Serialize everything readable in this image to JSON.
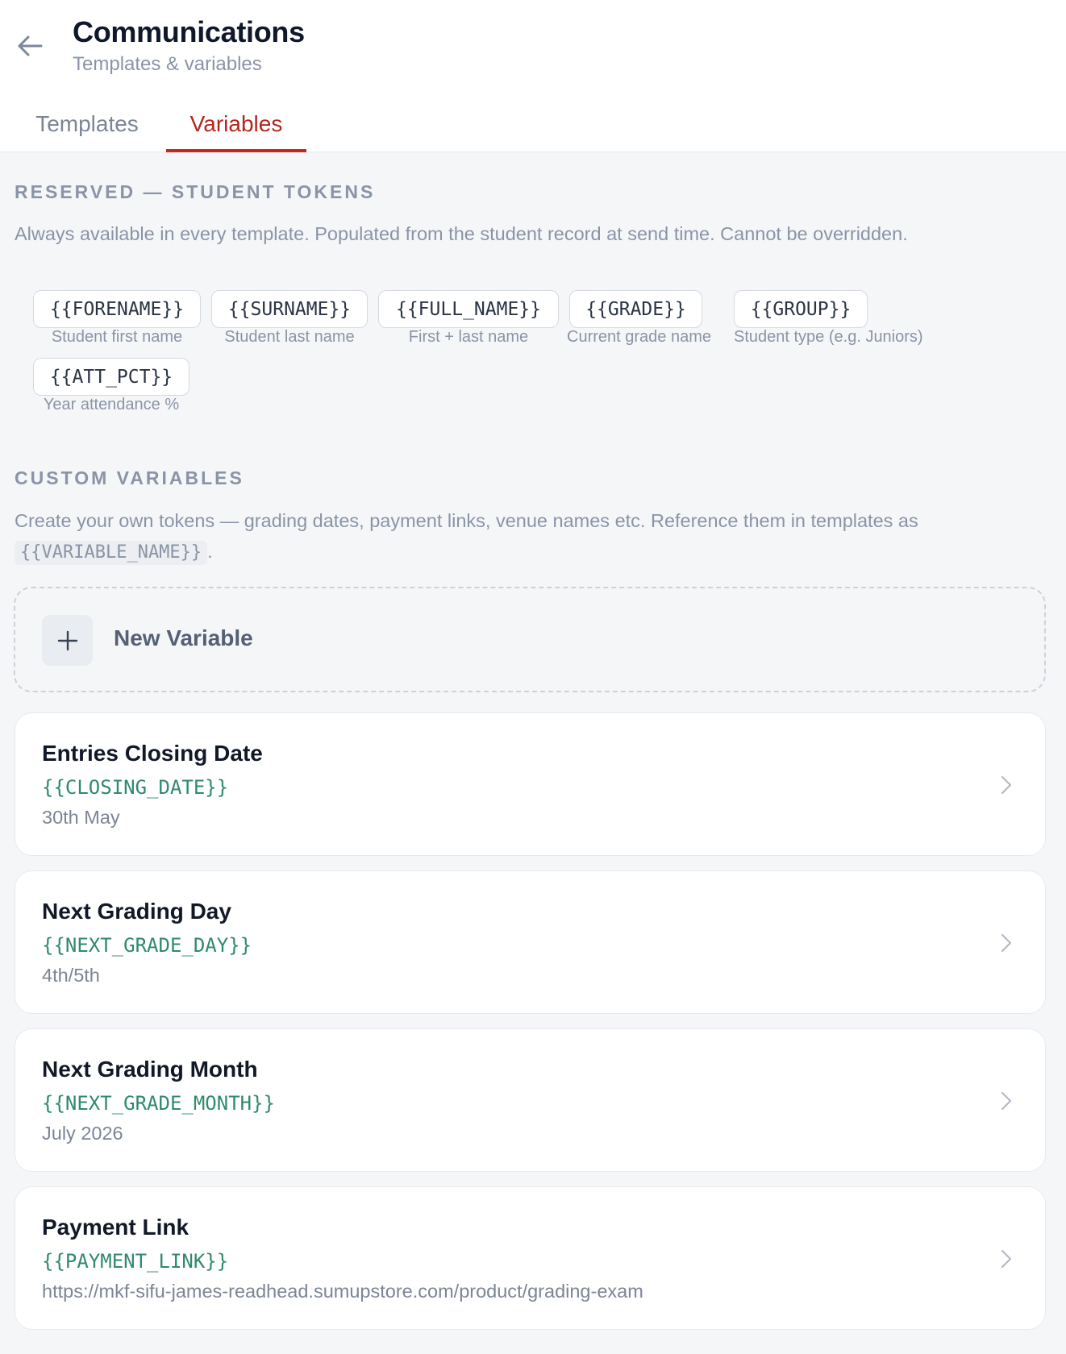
{
  "header": {
    "title": "Communications",
    "subtitle": "Templates & variables",
    "back_icon": "arrow-left-icon"
  },
  "tabs": [
    {
      "label": "Templates",
      "active": false
    },
    {
      "label": "Variables",
      "active": true
    }
  ],
  "reserved": {
    "heading": "RESERVED — STUDENT TOKENS",
    "description": "Always available in every template. Populated from the student record at send time. Cannot be overridden.",
    "tokens": [
      {
        "token": "{{FORENAME}}",
        "label": "Student first name"
      },
      {
        "token": "{{SURNAME}}",
        "label": "Student last name"
      },
      {
        "token": "{{FULL_NAME}}",
        "label": "First + last name"
      },
      {
        "token": "{{GRADE}}",
        "label": "Current grade name"
      },
      {
        "token": "{{GROUP}}",
        "label": "Student type (e.g. Juniors)"
      },
      {
        "token": "{{ATT_PCT}}",
        "label": "Year attendance %"
      }
    ]
  },
  "custom": {
    "heading": "CUSTOM VARIABLES",
    "description": "Create your own tokens — grading dates, payment links, venue names etc. Reference them in templates as",
    "example_token": "{{VARIABLE_NAME}}",
    "description_end": ".",
    "new_button_label": "New Variable",
    "variables": [
      {
        "name": "Entries Closing Date",
        "token": "{{CLOSING_DATE}}",
        "value": "30th May"
      },
      {
        "name": "Next Grading Day",
        "token": "{{NEXT_GRADE_DAY}}",
        "value": "4th/5th"
      },
      {
        "name": "Next Grading Month",
        "token": "{{NEXT_GRADE_MONTH}}",
        "value": "July 2026"
      },
      {
        "name": "Payment Link",
        "token": "{{PAYMENT_LINK}}",
        "value": "https://mkf-sifu-james-readhead.sumupstore.com/product/grading-exam"
      }
    ]
  },
  "colors": {
    "accent": "#c8281c",
    "token_green": "#2f8a6f",
    "muted_text": "#8a94a6",
    "background": "#f5f6f8"
  }
}
